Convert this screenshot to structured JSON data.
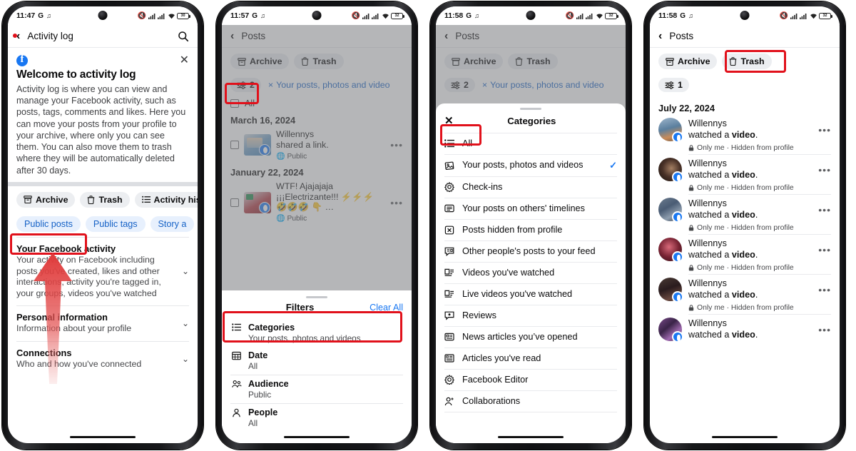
{
  "phones": [
    {
      "status": {
        "time": "11:47",
        "icons": [
          "G",
          "tiktok-note",
          "mute",
          "signal",
          "signal",
          "wifi",
          "battery"
        ],
        "battery": "30"
      },
      "appbar": {
        "back": "‹",
        "title": "Activity log",
        "action": "search-icon"
      },
      "welcome": {
        "heading": "Welcome to activity log",
        "body": "Activity log is where you can view and manage your Facebook activity, such as posts, tags, comments and likes. Here you can move your posts from your profile to your archive, where only you can see them. You can also move them to trash where they will be automatically deleted after 30 days.",
        "close": "✕"
      },
      "chips": [
        {
          "label": "Archive",
          "icon": "archive-icon"
        },
        {
          "label": "Trash",
          "icon": "trash-icon"
        },
        {
          "label": "Activity his",
          "icon": "list-icon"
        }
      ],
      "bluechips": [
        {
          "label": "Public posts",
          "highlighted": true
        },
        {
          "label": "Public tags",
          "highlighted": false
        },
        {
          "label": "Story a",
          "highlighted": false
        }
      ],
      "sections": [
        {
          "title": "Your Facebook activity",
          "sub": "Your activity on Facebook including posts you've created, likes and other interactions, activity you're tagged in, your groups, videos you've watched",
          "chevron": "⌄"
        },
        {
          "title": "Personal information",
          "sub": "Information about your profile",
          "chevron": "⌄"
        },
        {
          "title": "Connections",
          "sub": "Who and how you've connected",
          "chevron": "⌄"
        }
      ]
    },
    {
      "status": {
        "time": "11:57",
        "battery": "32"
      },
      "appbar": {
        "title": "Posts"
      },
      "chips": [
        {
          "label": "Archive",
          "icon": "archive-icon"
        },
        {
          "label": "Trash",
          "icon": "trash-icon"
        }
      ],
      "filterchip": {
        "count": "2",
        "icon": "sliders-icon",
        "highlighted": true
      },
      "activefilter": {
        "x": "×",
        "label": "Your posts, photos and video"
      },
      "selectall": "All",
      "posts": [
        {
          "date": "March 16, 2024",
          "name": "Willennys",
          "text": "shared a link.",
          "privacy": "Public",
          "more": "•••"
        },
        {
          "date": "January 22, 2024",
          "name": "",
          "text": "WTF! Ajajajaja ¡¡¡Electrizante!!! ⚡⚡⚡ 🤣🤣🤣 👇 …",
          "privacy": "Public",
          "more": "•••"
        }
      ],
      "sheet": {
        "title": "Filters",
        "clear": "Clear All",
        "rows": [
          {
            "icon": "list-icon",
            "title": "Categories",
            "sub": "Your posts, photos and videos",
            "highlighted": true
          },
          {
            "icon": "calendar-icon",
            "title": "Date",
            "sub": "All",
            "highlighted": false
          },
          {
            "icon": "audience-icon",
            "title": "Audience",
            "sub": "Public",
            "highlighted": false
          },
          {
            "icon": "person-icon",
            "title": "People",
            "sub": "All",
            "highlighted": false
          }
        ]
      }
    },
    {
      "status": {
        "time": "11:58",
        "battery": "32"
      },
      "appbar": {
        "title": "Posts"
      },
      "chips": [
        {
          "label": "Archive",
          "icon": "archive-icon"
        },
        {
          "label": "Trash",
          "icon": "trash-icon"
        }
      ],
      "filterchip": {
        "count": "2",
        "icon": "sliders-icon"
      },
      "activefilter": {
        "x": "×",
        "label": "Your posts, photos and video"
      },
      "sheet": {
        "close": "✕",
        "title": "Categories",
        "items": [
          {
            "icon": "list-icon",
            "label": "All",
            "checked": false,
            "highlighted": true
          },
          {
            "icon": "photo-icon",
            "label": "Your posts, photos and videos",
            "checked": true,
            "highlighted": false
          },
          {
            "icon": "gear-icon",
            "label": "Check-ins",
            "checked": false,
            "highlighted": false
          },
          {
            "icon": "timeline-icon",
            "label": "Your posts on others' timelines",
            "checked": false,
            "highlighted": false
          },
          {
            "icon": "hidden-icon",
            "label": "Posts hidden from profile",
            "checked": false,
            "highlighted": false
          },
          {
            "icon": "feedpost-icon",
            "label": "Other people's posts to your feed",
            "checked": false,
            "highlighted": false
          },
          {
            "icon": "video-icon",
            "label": "Videos you've watched",
            "checked": false,
            "highlighted": false
          },
          {
            "icon": "video-icon",
            "label": "Live videos you've watched",
            "checked": false,
            "highlighted": false
          },
          {
            "icon": "review-icon",
            "label": "Reviews",
            "checked": false,
            "highlighted": false
          },
          {
            "icon": "news-icon",
            "label": "News articles you’ve opened",
            "checked": false,
            "highlighted": false
          },
          {
            "icon": "article-icon",
            "label": "Articles you've read",
            "checked": false,
            "highlighted": false
          },
          {
            "icon": "gear-icon",
            "label": "Facebook Editor",
            "checked": false,
            "highlighted": false
          },
          {
            "icon": "person-add-icon",
            "label": "Collaborations",
            "checked": false,
            "highlighted": false
          }
        ]
      }
    },
    {
      "status": {
        "time": "11:58",
        "battery": "32"
      },
      "appbar": {
        "title": "Posts"
      },
      "chips": [
        {
          "label": "Archive",
          "icon": "archive-icon",
          "highlighted": false
        },
        {
          "label": "Trash",
          "icon": "trash-icon",
          "highlighted": true
        }
      ],
      "filterchip": {
        "count": "1",
        "icon": "sliders-icon"
      },
      "datehdr": "July 22, 2024",
      "items": [
        {
          "name": "Willennys",
          "action": "watched a",
          "bold": "video",
          "suffix": ".",
          "meta": "Only me · Hidden from profile",
          "more": "•••",
          "c1": "#7e99b4",
          "c2": "#c8906a"
        },
        {
          "name": "Willennys",
          "action": "watched a",
          "bold": "video",
          "suffix": ".",
          "meta": "Only me · Hidden from profile",
          "more": "•••",
          "c1": "#3a2a24",
          "c2": "#8d6a55"
        },
        {
          "name": "Willennys",
          "action": "watched a",
          "bold": "video",
          "suffix": ".",
          "meta": "Only me · Hidden from profile",
          "more": "•••",
          "c1": "#4a5a70",
          "c2": "#9aa8bb"
        },
        {
          "name": "Willennys",
          "action": "watched a",
          "bold": "video",
          "suffix": ".",
          "meta": "Only me · Hidden from profile",
          "more": "•••",
          "c1": "#5a2030",
          "c2": "#b05a6a"
        },
        {
          "name": "Willennys",
          "action": "watched a",
          "bold": "video",
          "suffix": ".",
          "meta": "Only me · Hidden from profile",
          "more": "•••",
          "c1": "#2c1d20",
          "c2": "#6a4a42"
        },
        {
          "name": "Willennys",
          "action": "watched a",
          "bold": "video",
          "suffix": ".",
          "meta": "",
          "more": "•••",
          "c1": "#4a2a50",
          "c2": "#9a6aa0"
        }
      ],
      "lock": "🔒"
    }
  ],
  "colors": {
    "highlight": "#e1111b",
    "fb_blue": "#1877f2",
    "link_blue": "#1461c6",
    "arrow_red": "#e24a4a"
  }
}
